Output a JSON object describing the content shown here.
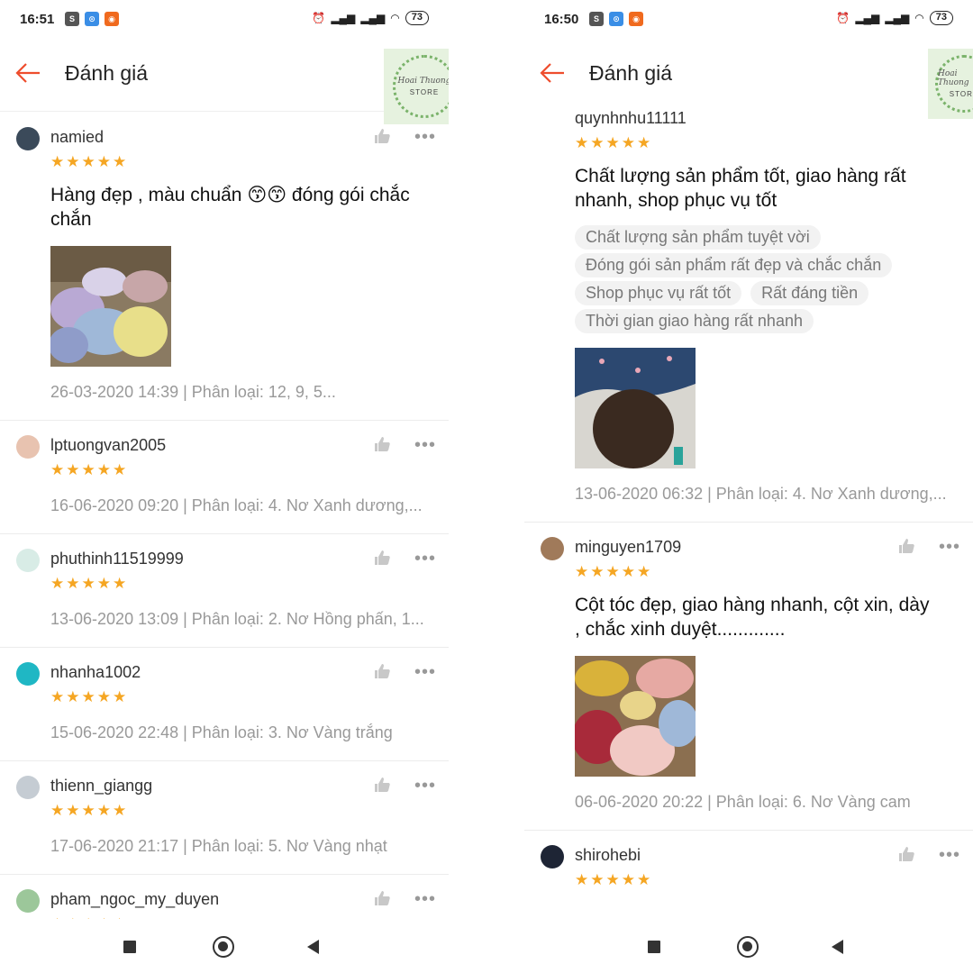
{
  "screens": [
    {
      "status": {
        "time": "16:51",
        "battery": "73"
      },
      "header": {
        "title": "Đánh giá"
      },
      "logo": {
        "script": "Hoai Thuong",
        "store": "STORE"
      },
      "reviews": [
        {
          "user": "namied",
          "stars": "★★★★★",
          "comment": "Hàng đẹp , màu chuẩn 😙😙 đóng gói chắc chắn",
          "tags": [],
          "photo": "scrunchies",
          "meta": "26-03-2020 14:39 | Phân loại: 12, 9, 5..."
        },
        {
          "user": "lptuongvan2005",
          "stars": "★★★★★",
          "comment": "",
          "tags": [],
          "photo": "",
          "meta": "16-06-2020 09:20 | Phân loại: 4. Nơ Xanh dương,..."
        },
        {
          "user": "phuthinh11519999",
          "stars": "★★★★★",
          "comment": "",
          "tags": [],
          "photo": "",
          "meta": "13-06-2020 13:09 | Phân loại: 2. Nơ Hồng phấn, 1..."
        },
        {
          "user": "nhanha1002",
          "stars": "★★★★★",
          "comment": "",
          "tags": [],
          "photo": "",
          "meta": "15-06-2020 22:48 | Phân loại: 3. Nơ Vàng trắng"
        },
        {
          "user": "thienn_giangg",
          "stars": "★★★★★",
          "comment": "",
          "tags": [],
          "photo": "",
          "meta": "17-06-2020 21:17 | Phân loại: 5. Nơ Vàng nhạt"
        },
        {
          "user": "pham_ngoc_my_duyen",
          "stars": "★★★★★",
          "comment": "",
          "tags": [],
          "photo": "",
          "meta": ""
        }
      ]
    },
    {
      "status": {
        "time": "16:50",
        "battery": "73"
      },
      "header": {
        "title": "Đánh giá"
      },
      "logo": {
        "script": "Hoai Thuong",
        "store": "STORE"
      },
      "reviews": [
        {
          "user": "quynhnhu11111",
          "stars": "★★★★★",
          "comment": "Chất lượng sản phẩm tốt, giao hàng rất nhanh, shop phục vụ tốt",
          "tags": [
            "Chất lượng sản phẩm tuyệt vời",
            "Đóng gói sản phẩm rất đẹp và chắc chắn",
            "Shop phục vụ rất tốt",
            "Rất đáng tiền",
            "Thời gian giao hàng rất nhanh"
          ],
          "photo": "bow-hair",
          "meta": "13-06-2020 06:32 | Phân loại: 4. Nơ Xanh dương,..."
        },
        {
          "user": "minguyen1709",
          "stars": "★★★★★",
          "comment": "Cột tóc đẹp, giao hàng nhanh, cột xin, dày , chắc xinh duyệt.............",
          "tags": [],
          "photo": "scrunchies-2",
          "meta": "06-06-2020 20:22 | Phân loại: 6. Nơ Vàng cam"
        },
        {
          "user": "shirohebi",
          "stars": "★★★★★",
          "comment": "",
          "tags": [],
          "photo": "",
          "meta": ""
        }
      ]
    }
  ],
  "colors": {
    "star": "#f5a623",
    "accent": "#ee4d2d"
  }
}
